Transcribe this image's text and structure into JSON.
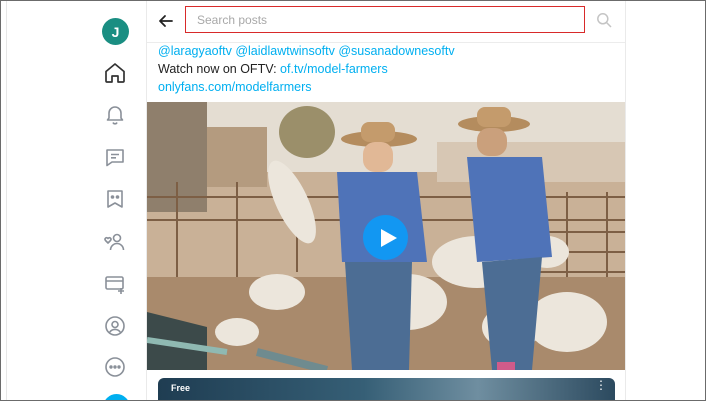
{
  "sidebar": {
    "avatar_initial": "J",
    "items": [
      {
        "icon": "home-icon"
      },
      {
        "icon": "bell-icon"
      },
      {
        "icon": "messages-icon"
      },
      {
        "icon": "collections-icon"
      },
      {
        "icon": "subscriptions-icon"
      },
      {
        "icon": "add-card-icon"
      },
      {
        "icon": "profile-icon"
      },
      {
        "icon": "more-icon"
      }
    ]
  },
  "header": {
    "search_placeholder": "Search posts",
    "search_value": ""
  },
  "post": {
    "mentions": [
      "@laragyaoftv",
      "@laidlawtwinsoftv",
      "@susanadownesoftv"
    ],
    "watch_prefix": "Watch now on OFTV:",
    "watch_link": "of.tv/model-farmers",
    "profile_link": "onlyfans.com/modelfarmers"
  },
  "next_card": {
    "badge": "Free",
    "menu": "⋮"
  },
  "colors": {
    "accent": "#00aff0",
    "avatar": "#1a8e82",
    "search_border": "#d82a2a",
    "play": "#1297f2"
  }
}
